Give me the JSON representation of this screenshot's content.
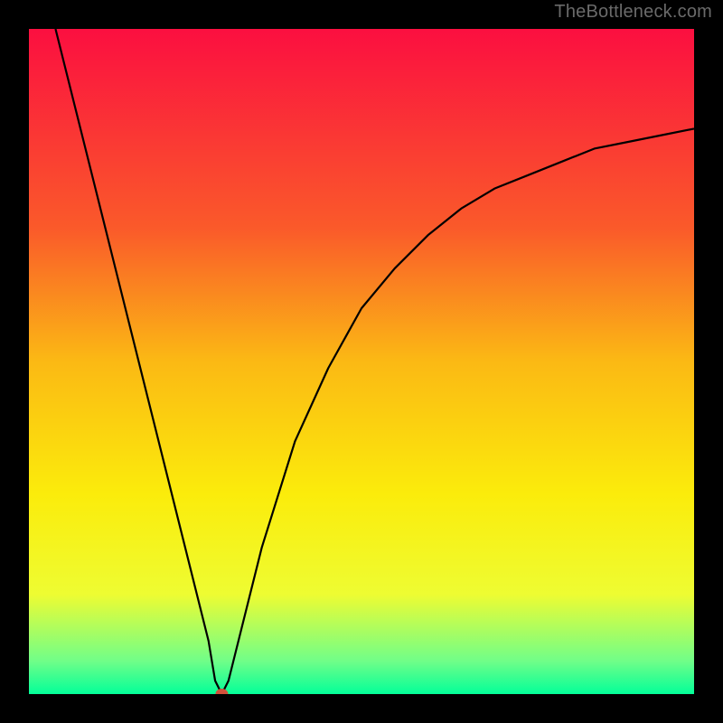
{
  "watermark": "TheBottleneck.com",
  "chart_data": {
    "type": "line",
    "title": "",
    "xlabel": "",
    "ylabel": "",
    "xlim": [
      0,
      100
    ],
    "ylim": [
      0,
      100
    ],
    "marker": {
      "x": 29,
      "y": 0,
      "color": "#d2513b"
    },
    "curve_points": [
      {
        "x": 4,
        "y": 100
      },
      {
        "x": 10,
        "y": 76
      },
      {
        "x": 15,
        "y": 56
      },
      {
        "x": 20,
        "y": 36
      },
      {
        "x": 25,
        "y": 16
      },
      {
        "x": 27,
        "y": 8
      },
      {
        "x": 28,
        "y": 2
      },
      {
        "x": 29,
        "y": 0
      },
      {
        "x": 30,
        "y": 2
      },
      {
        "x": 32,
        "y": 10
      },
      {
        "x": 35,
        "y": 22
      },
      {
        "x": 40,
        "y": 38
      },
      {
        "x": 45,
        "y": 49
      },
      {
        "x": 50,
        "y": 58
      },
      {
        "x": 55,
        "y": 64
      },
      {
        "x": 60,
        "y": 69
      },
      {
        "x": 65,
        "y": 73
      },
      {
        "x": 70,
        "y": 76
      },
      {
        "x": 75,
        "y": 78
      },
      {
        "x": 80,
        "y": 80
      },
      {
        "x": 85,
        "y": 82
      },
      {
        "x": 90,
        "y": 83
      },
      {
        "x": 95,
        "y": 84
      },
      {
        "x": 100,
        "y": 85
      }
    ],
    "background_gradient": [
      {
        "offset": 0,
        "color": "#fb0f40"
      },
      {
        "offset": 30,
        "color": "#fa5a2a"
      },
      {
        "offset": 50,
        "color": "#fbb914"
      },
      {
        "offset": 70,
        "color": "#fbec0b"
      },
      {
        "offset": 85,
        "color": "#eefc32"
      },
      {
        "offset": 95,
        "color": "#71fe88"
      },
      {
        "offset": 100,
        "color": "#03ff99"
      }
    ],
    "frame": {
      "stroke": "#000000",
      "stroke_width_ratio": 0.04
    }
  }
}
